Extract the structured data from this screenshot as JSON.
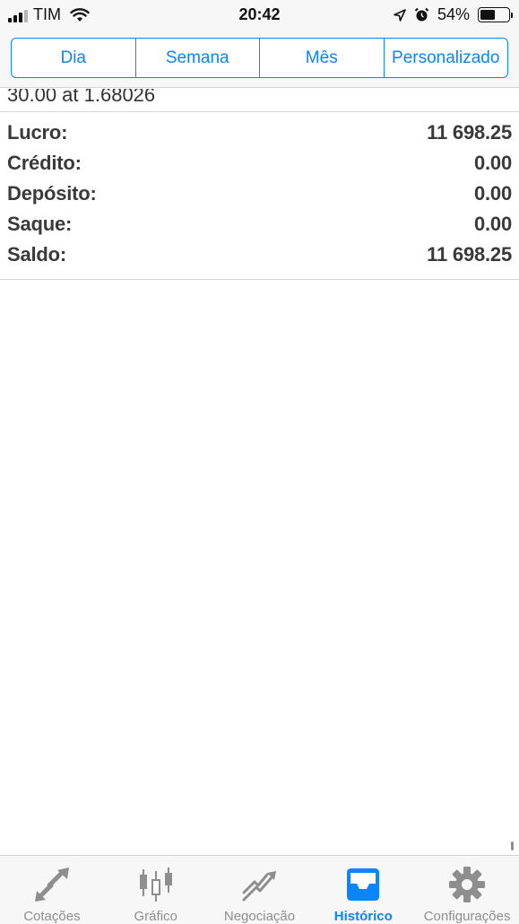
{
  "status_bar": {
    "carrier": "TIM",
    "time": "20:42",
    "battery_percent": "54%",
    "battery_level": 0.54
  },
  "segments": [
    {
      "label": "Dia",
      "active": true
    },
    {
      "label": "Semana",
      "active": false
    },
    {
      "label": "Mês",
      "active": false
    },
    {
      "label": "Personalizado",
      "active": false
    }
  ],
  "deal_line": "30.00 at 1.68026",
  "summary": [
    {
      "label": "Lucro:",
      "value": "11 698.25"
    },
    {
      "label": "Crédito:",
      "value": "0.00"
    },
    {
      "label": "Depósito:",
      "value": "0.00"
    },
    {
      "label": "Saque:",
      "value": "0.00"
    },
    {
      "label": "Saldo:",
      "value": "11 698.25"
    }
  ],
  "tabs": [
    {
      "label": "Cotações",
      "icon": "quotes-arrows-icon",
      "active": false
    },
    {
      "label": "Gráfico",
      "icon": "candlestick-chart-icon",
      "active": false
    },
    {
      "label": "Negociação",
      "icon": "trade-chart-icon",
      "active": false
    },
    {
      "label": "Histórico",
      "icon": "inbox-tray-icon",
      "active": true
    },
    {
      "label": "Configurações",
      "icon": "gear-icon",
      "active": false
    }
  ],
  "colors": {
    "accent": "#0a84ff",
    "inactive": "#8e8e8e"
  }
}
